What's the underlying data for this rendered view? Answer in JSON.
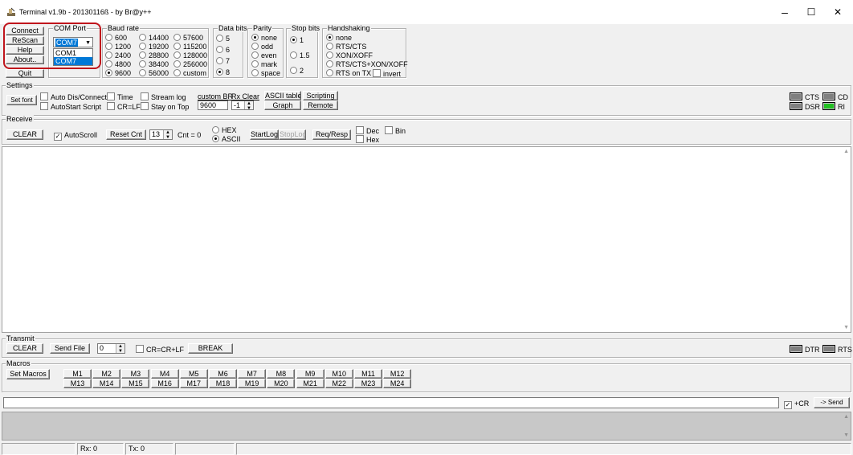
{
  "window": {
    "title": "Terminal v1.9b - 20130116ß - by Br@y++",
    "minimize": "–",
    "maximize": "☐",
    "close": "✕"
  },
  "connection": {
    "connect": "Connect",
    "rescan": "ReScan",
    "help": "Help",
    "about": "About..",
    "quit": "Quit"
  },
  "com_port": {
    "label": "COM Port",
    "selected": "COM7",
    "options": [
      "COM1",
      "COM7"
    ]
  },
  "baud_rate": {
    "label": "Baud rate",
    "options": [
      "600",
      "1200",
      "2400",
      "4800",
      "9600",
      "14400",
      "19200",
      "28800",
      "38400",
      "56000",
      "57600",
      "115200",
      "128000",
      "256000",
      "custom"
    ],
    "selected": "9600"
  },
  "data_bits": {
    "label": "Data bits",
    "options": [
      "5",
      "6",
      "7",
      "8"
    ],
    "selected": "8"
  },
  "parity": {
    "label": "Parity",
    "options": [
      "none",
      "odd",
      "even",
      "mark",
      "space"
    ],
    "selected": "none"
  },
  "stop_bits": {
    "label": "Stop bits",
    "options": [
      "1",
      "1.5",
      "2"
    ],
    "selected": "1"
  },
  "handshaking": {
    "label": "Handshaking",
    "options": [
      "none",
      "RTS/CTS",
      "XON/XOFF",
      "RTS/CTS+XON/XOFF",
      "RTS on TX"
    ],
    "selected": "none",
    "invert": "invert"
  },
  "settings": {
    "label": "Settings",
    "set_font": "Set font",
    "auto_dis_connect": "Auto Dis/Connect",
    "autostart_script": "AutoStart Script",
    "time": "Time",
    "cr_lf": "CR=LF",
    "stream_log": "Stream log",
    "stay_on_top": "Stay on Top",
    "custom_br": "custom BR",
    "custom_br_value": "9600",
    "rx_clear": "Rx Clear",
    "rx_clear_value": "-1",
    "ascii_table": "ASCII table",
    "graph": "Graph",
    "scripting": "Scripting",
    "remote": "Remote"
  },
  "indicators": {
    "cts": "CTS",
    "cd": "CD",
    "dsr": "DSR",
    "ri": "RI",
    "dtr": "DTR",
    "rts": "RTS"
  },
  "receive": {
    "label": "Receive",
    "clear": "CLEAR",
    "autoscroll": "AutoScroll",
    "reset_cnt": "Reset Cnt",
    "cnt_value": "13",
    "cnt_label": "Cnt = 0",
    "hex": "HEX",
    "ascii": "ASCII",
    "start_log": "StartLog",
    "stop_log": "StopLog",
    "req_resp": "Req/Resp",
    "dec": "Dec",
    "hex2": "Hex",
    "bin": "Bin"
  },
  "transmit": {
    "label": "Transmit",
    "clear": "CLEAR",
    "send_file": "Send File",
    "value": "0",
    "cr_crlf": "CR=CR+LF",
    "break": "BREAK"
  },
  "macros": {
    "label": "Macros",
    "set_macros": "Set Macros",
    "row1": [
      "M1",
      "M2",
      "M3",
      "M4",
      "M5",
      "M6",
      "M7",
      "M8",
      "M9",
      "M10",
      "M11",
      "M12"
    ],
    "row2": [
      "M13",
      "M14",
      "M15",
      "M16",
      "M17",
      "M18",
      "M19",
      "M20",
      "M21",
      "M22",
      "M23",
      "M24"
    ]
  },
  "send": {
    "plus_cr": "+CR",
    "send": "-> Send"
  },
  "status": {
    "rx": "Rx: 0",
    "tx": "Tx: 0"
  }
}
